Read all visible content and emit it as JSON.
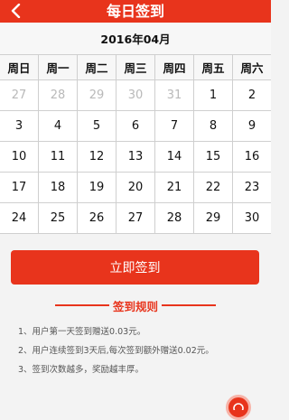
{
  "header": {
    "title": "每日签到",
    "back_icon": "chevron-left-icon"
  },
  "calendar": {
    "month_label": "2016年04月",
    "weekdays": [
      "周日",
      "周一",
      "周二",
      "周三",
      "周四",
      "周五",
      "周六"
    ],
    "rows": [
      [
        "27",
        "28",
        "29",
        "30",
        "31",
        "1",
        "2"
      ],
      [
        "3",
        "4",
        "5",
        "6",
        "7",
        "8",
        "9"
      ],
      [
        "10",
        "11",
        "12",
        "13",
        "14",
        "15",
        "16"
      ],
      [
        "17",
        "18",
        "19",
        "20",
        "21",
        "22",
        "23"
      ],
      [
        "24",
        "25",
        "26",
        "27",
        "28",
        "29",
        "30"
      ]
    ],
    "muted_color": "#b9b9b9"
  },
  "checkin_button": {
    "label": "立即签到"
  },
  "rules": {
    "title": "签到规则",
    "items": [
      "1、用户第一天签到赠送0.03元。",
      "2、用户连续签到3天后,每次签到额外赠送0.02元。",
      "3、签到次数越多，奖励越丰厚。"
    ]
  },
  "theme": {
    "accent": "#e8341c",
    "background": "#f3f3f3"
  },
  "fab": {
    "icon": "red-circle-fab-icon"
  }
}
